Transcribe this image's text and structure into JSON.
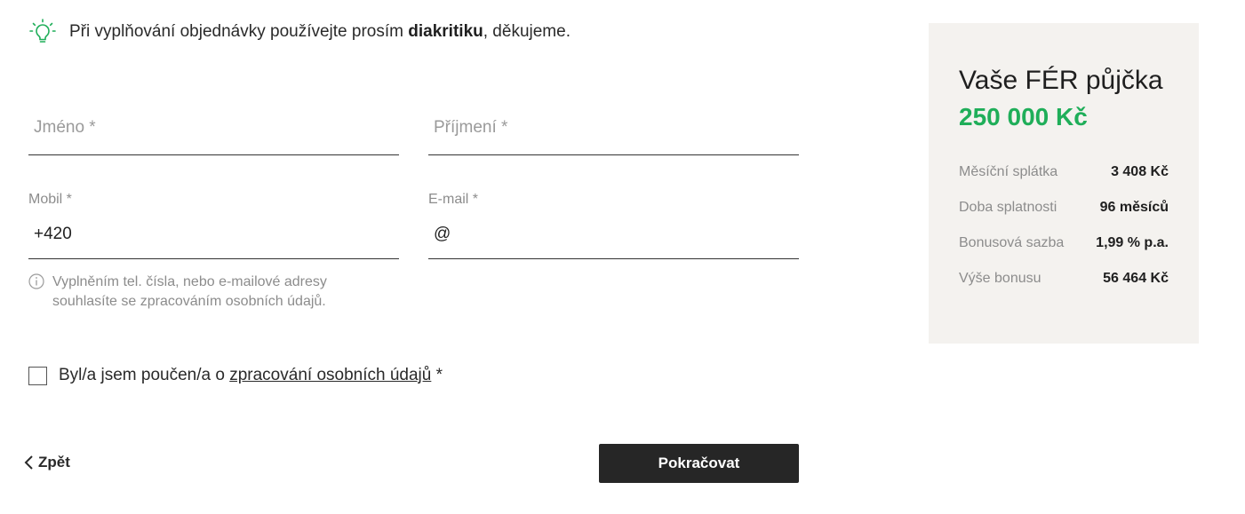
{
  "hint": {
    "prefix": "Při vyplňování objednávky používejte prosím ",
    "bold": "diakritiku",
    "suffix": ", děkujeme."
  },
  "form": {
    "first_name_placeholder": "Jméno *",
    "last_name_placeholder": "Příjmení *",
    "mobile_label": "Mobil *",
    "mobile_value": "+420",
    "email_label": "E-mail *",
    "email_value": "@",
    "info_line1": "Vyplněním tel. čísla, nebo e-mailové adresy",
    "info_line2": "souhlasíte se zpracováním osobních údajů.",
    "consent_prefix": "Byl/a jsem poučen/a o ",
    "consent_link": "zpracování osobních údajů",
    "consent_suffix": " *"
  },
  "nav": {
    "back_label": "Zpět",
    "continue_label": "Pokračovat"
  },
  "summary": {
    "title": "Vaše FÉR půjčka",
    "amount": "250 000 Kč",
    "rows": [
      {
        "label": "Měsíční splátka",
        "value": "3 408 Kč"
      },
      {
        "label": "Doba splatnosti",
        "value": "96 měsíců"
      },
      {
        "label": "Bonusová sazba",
        "value": "1,99 % p.a."
      },
      {
        "label": "Výše bonusu",
        "value": "56 464 Kč"
      }
    ]
  },
  "colors": {
    "accent_green": "#1fae59",
    "button_dark": "#262626",
    "card_bg": "#f4f2ef"
  },
  "icons": {
    "hint": "lightbulb-icon",
    "info": "info-icon",
    "back": "chevron-left-icon"
  }
}
